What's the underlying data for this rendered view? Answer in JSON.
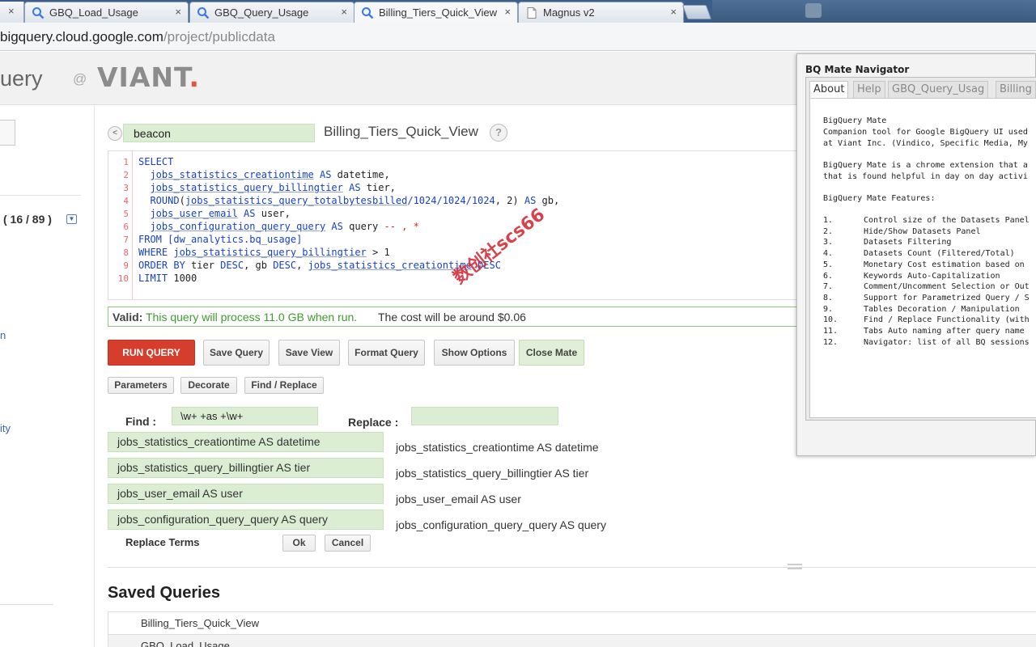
{
  "browser": {
    "tabs": [
      {
        "title": "GBQ_Load_Usage",
        "close": "×"
      },
      {
        "title": "GBQ_Query_Usage",
        "close": "×"
      },
      {
        "title": "Billing_Tiers_Quick_View",
        "close": "×"
      },
      {
        "title": "Magnus v2",
        "close": "×"
      }
    ],
    "first_tab_close": "×",
    "url_host": "bigquery.cloud.google.com",
    "url_path": "/project/publicdata"
  },
  "header": {
    "brand": "uery",
    "at": "@",
    "logo": "VIANT",
    "logo_dot": "."
  },
  "sidebar": {
    "count": "( 16 / 89 )",
    "dropdown": "▼",
    "fragment_n": "n",
    "fragment_ity": "ity"
  },
  "query": {
    "back_icon": "<",
    "dataset": "beacon",
    "title": "Billing_Tiers_Quick_View",
    "help": "?",
    "line_numbers": [
      "1",
      "2",
      "3",
      "4",
      "5",
      "6",
      "7",
      "8",
      "9",
      "10"
    ]
  },
  "validation": {
    "label": "Valid:",
    "message": "This query will process 11.0 GB when run.",
    "cost": "The cost will be around $0.06"
  },
  "buttons": {
    "run": "RUN QUERY",
    "save_query": "Save Query",
    "save_view": "Save View",
    "format_query": "Format Query",
    "show_options": "Show Options",
    "close_mate": "Close Mate",
    "parameters": "Parameters",
    "decorate": "Decorate",
    "find_replace": "Find / Replace",
    "ok": "Ok",
    "cancel": "Cancel"
  },
  "find_replace": {
    "find_label": "Find :",
    "find_value": "\\w+ +as +\\w+",
    "replace_label": "Replace :",
    "replace_value": "",
    "matches": [
      "jobs_statistics_creationtime AS datetime",
      "jobs_statistics_query_billingtier AS tier",
      "jobs_user_email AS user",
      "jobs_configuration_query_query AS query"
    ],
    "results": [
      "jobs_statistics_creationtime AS datetime",
      "jobs_statistics_query_billingtier AS tier",
      "jobs_user_email AS user",
      "jobs_configuration_query_query AS query"
    ],
    "replace_terms": "Replace Terms"
  },
  "saved": {
    "title": "Saved Queries",
    "items": [
      "Billing_Tiers_Quick_View",
      "GBQ_Load_Usage"
    ]
  },
  "watermark": "数创社scs66",
  "navigator": {
    "title": "BQ Mate Navigator",
    "tabs": [
      "About",
      "Help",
      "GBQ_Query_Usag",
      "Billing"
    ],
    "intro_heading": "BigQuery Mate",
    "intro_1": "Companion tool for Google BigQuery UI used",
    "intro_2": "at Viant Inc. (Vindico, Specific Media, My",
    "desc_1": "BigQuery Mate is a chrome extension that a",
    "desc_2": "that is found helpful in day on day activi",
    "features_heading": "BigQuery Mate Features:",
    "features": [
      {
        "num": "1.",
        "text": "Control size of the Datasets Panel"
      },
      {
        "num": "2.",
        "text": "Hide/Show Datasets Panel"
      },
      {
        "num": "3.",
        "text": "Datasets Filtering"
      },
      {
        "num": "4.",
        "text": "Datasets Count (Filtered/Total)"
      },
      {
        "num": "5.",
        "text": "Monetary Cost estimation based on"
      },
      {
        "num": "6.",
        "text": "Keywords Auto-Capitalization"
      },
      {
        "num": "7.",
        "text": "Comment/Uncomment Selection or Out"
      },
      {
        "num": "8.",
        "text": "Support for Parametrized Query / S"
      },
      {
        "num": "9.",
        "text": "Tables Decoration / Manipulation"
      },
      {
        "num": "10.",
        "text": "Find / Replace Functionality (with"
      },
      {
        "num": "11.",
        "text": "Tabs Auto naming after query name"
      },
      {
        "num": "12.",
        "text": "Navigator: list of all BQ sessions"
      }
    ]
  },
  "colors": {
    "run_button": "#d53d2c",
    "valid_green": "#3f9a2f",
    "keyword_blue": "#1a40c8",
    "input_green": "#dbeed3"
  }
}
